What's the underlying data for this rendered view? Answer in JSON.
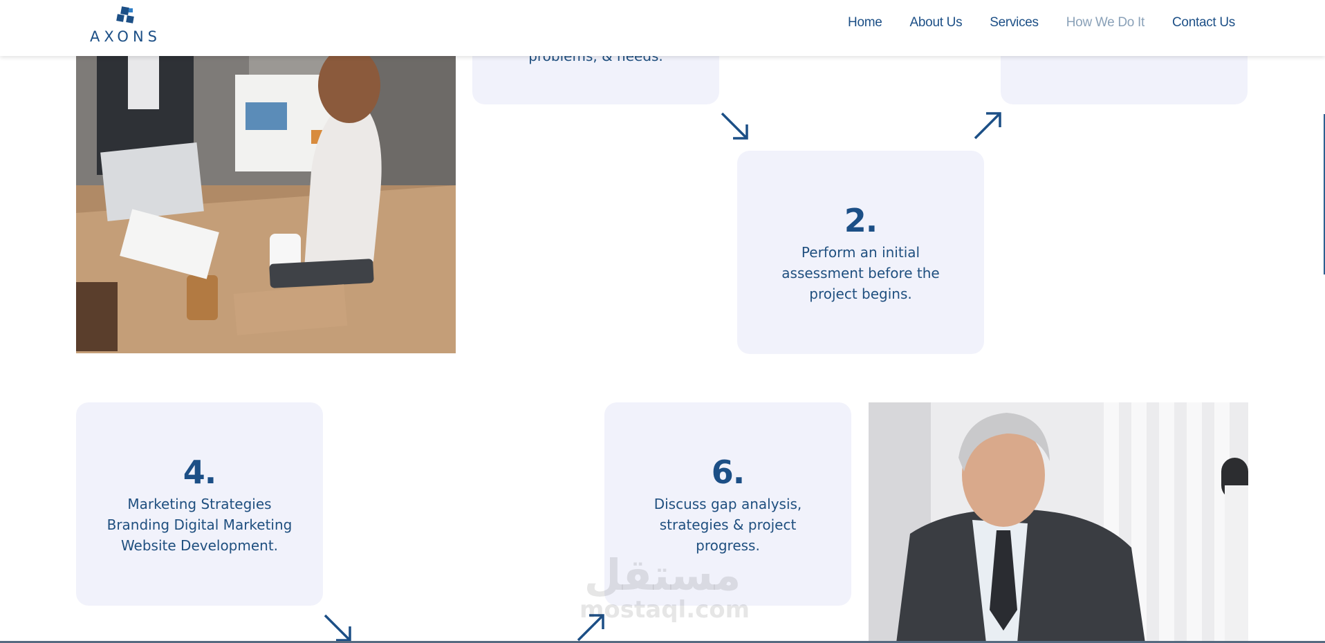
{
  "brand": {
    "name": "AXONS",
    "primary_color": "#1c4f86",
    "card_bg": "#f1f2fb"
  },
  "nav": {
    "items": [
      {
        "label": "Home",
        "active": false
      },
      {
        "label": "About Us",
        "active": false
      },
      {
        "label": "Services",
        "active": false
      },
      {
        "label": "How We Do It",
        "active": true
      },
      {
        "label": "Contact Us",
        "active": false
      }
    ]
  },
  "steps": {
    "top_left": {
      "text": "problems, & needs."
    },
    "step2": {
      "number": "2.",
      "text": "Perform an initial assessment before the project begins."
    },
    "step4": {
      "number": "4.",
      "text": "Marketing Strategies Branding Digital Marketing Website Development."
    },
    "step6": {
      "number": "6.",
      "text": "Discuss gap analysis, strategies & project progress."
    }
  },
  "icons": [
    "arrow-down-right-icon",
    "arrow-up-right-icon"
  ],
  "watermark": {
    "arabic": "مستقل",
    "latin": "mostaql.com"
  }
}
